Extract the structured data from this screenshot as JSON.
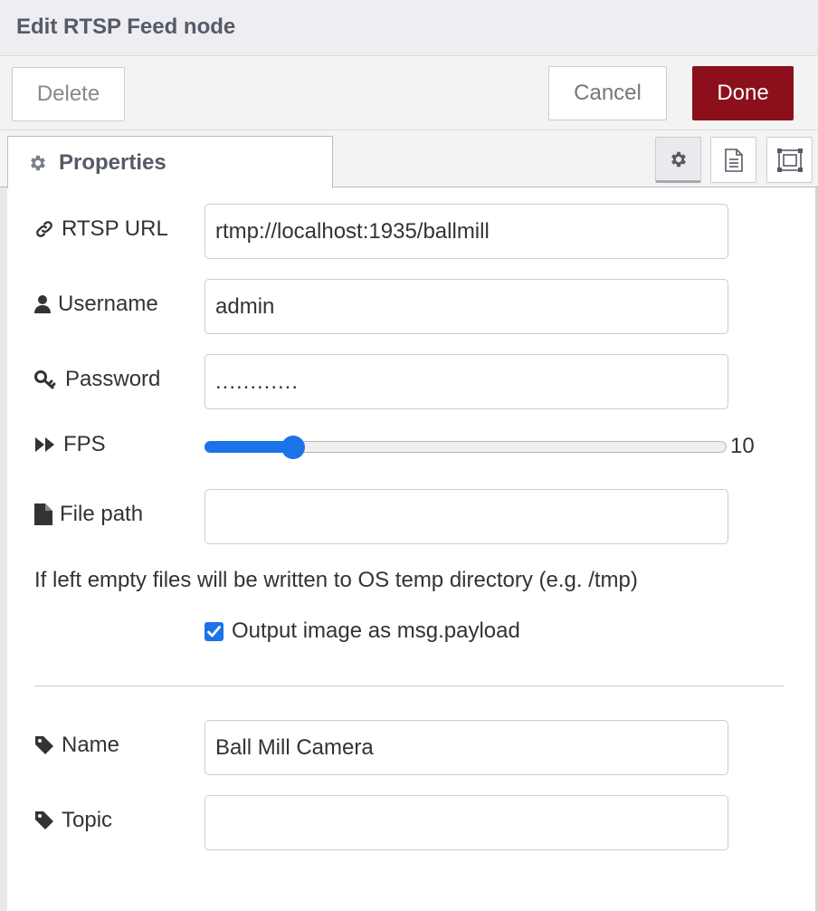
{
  "dialog": {
    "title": "Edit RTSP Feed node"
  },
  "toolbar": {
    "delete_label": "Delete",
    "cancel_label": "Cancel",
    "done_label": "Done"
  },
  "tabs": {
    "properties_label": "Properties",
    "icons": [
      "gear-icon",
      "description-icon",
      "appearance-icon"
    ]
  },
  "form": {
    "rtsp_url": {
      "label": "RTSP URL",
      "value": "rtmp://localhost:1935/ballmill",
      "icon": "link-icon"
    },
    "username": {
      "label": "Username",
      "value": "admin",
      "icon": "user-icon"
    },
    "password": {
      "label": "Password",
      "value": "............",
      "icon": "key-icon"
    },
    "fps": {
      "label": "FPS",
      "value": "10",
      "slider_fraction": 0.17,
      "icon": "fast-forward-icon"
    },
    "file_path": {
      "label": "File path",
      "value": "",
      "icon": "file-icon"
    },
    "hint": "If left empty files will be written to OS temp directory (e.g. /tmp)",
    "output_image": {
      "label": "Output image as msg.payload",
      "checked": true
    },
    "name": {
      "label": "Name",
      "value": "Ball Mill Camera",
      "icon": "tag-icon"
    },
    "topic": {
      "label": "Topic",
      "value": "",
      "icon": "tag-icon"
    }
  },
  "colors": {
    "done_button": "#8c101c",
    "accent_blue": "#1a73e8",
    "title_text": "#555a66"
  }
}
